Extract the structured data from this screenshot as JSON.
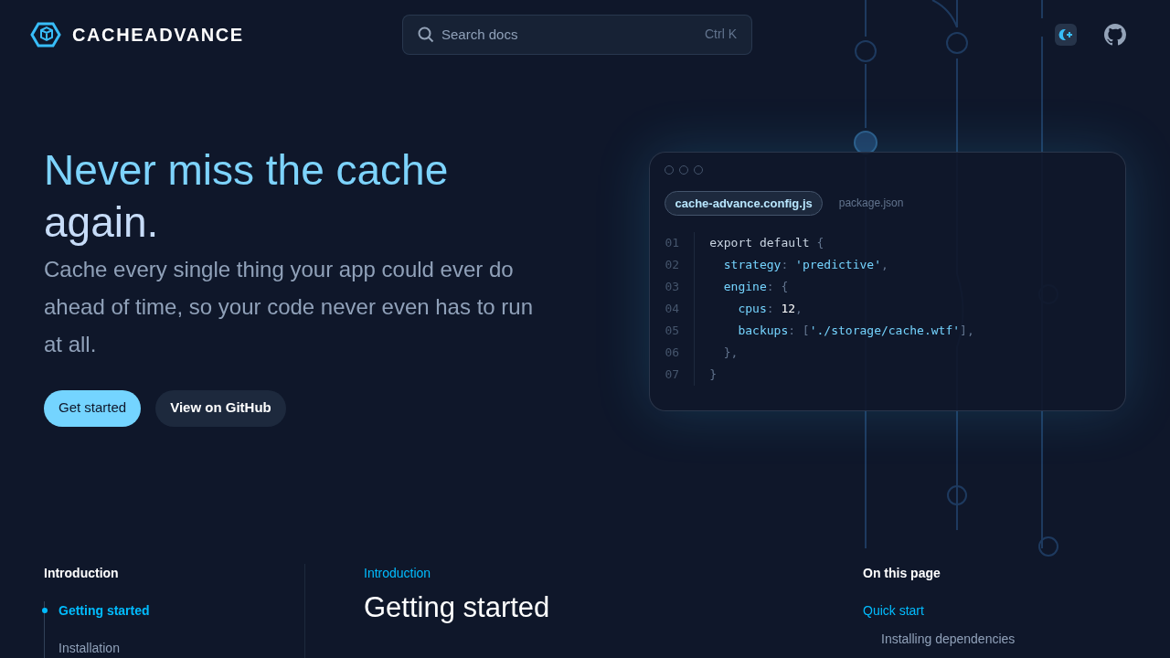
{
  "header": {
    "logo": "CACHEADVANCE",
    "search": {
      "placeholder": "Search docs",
      "shortcut": "Ctrl K"
    }
  },
  "hero": {
    "title_lead": "Never miss the cache",
    "title_rest": "again.",
    "lead": "Cache every single thing your app could ever do ahead of time, so your code never even has to run at all.",
    "buttons": [
      {
        "label": "Get started",
        "kind": "primary"
      },
      {
        "label": "View on GitHub",
        "kind": "secondary"
      }
    ]
  },
  "code_window": {
    "tabs": [
      {
        "label": "cache-advance.config.js",
        "selected": true
      },
      {
        "label": "package.json",
        "selected": false
      }
    ],
    "lines": [
      {
        "number": "01",
        "tokens": [
          {
            "text": "export default ",
            "kind": "plain"
          },
          {
            "text": "{",
            "kind": "punct"
          }
        ]
      },
      {
        "number": "02",
        "tokens": [
          {
            "text": "  strategy",
            "kind": "key"
          },
          {
            "text": ": ",
            "kind": "punct"
          },
          {
            "text": "'predictive'",
            "kind": "string"
          },
          {
            "text": ",",
            "kind": "punct"
          }
        ]
      },
      {
        "number": "03",
        "tokens": [
          {
            "text": "  engine",
            "kind": "key"
          },
          {
            "text": ": {",
            "kind": "punct"
          }
        ]
      },
      {
        "number": "04",
        "tokens": [
          {
            "text": "    cpus",
            "kind": "key"
          },
          {
            "text": ": ",
            "kind": "punct"
          },
          {
            "text": "12",
            "kind": "number"
          },
          {
            "text": ",",
            "kind": "punct"
          }
        ]
      },
      {
        "number": "05",
        "tokens": [
          {
            "text": "    backups",
            "kind": "key"
          },
          {
            "text": ": [",
            "kind": "punct"
          },
          {
            "text": "'./storage/cache.wtf'",
            "kind": "string"
          },
          {
            "text": "],",
            "kind": "punct"
          }
        ]
      },
      {
        "number": "06",
        "tokens": [
          {
            "text": "  },",
            "kind": "punct"
          }
        ]
      },
      {
        "number": "07",
        "tokens": [
          {
            "text": "}",
            "kind": "punct"
          }
        ]
      }
    ]
  },
  "sidebar": {
    "heading": "Introduction",
    "items": [
      {
        "label": "Getting started",
        "selected": true
      },
      {
        "label": "Installation",
        "selected": false
      }
    ]
  },
  "article": {
    "eyebrow": "Introduction",
    "title": "Getting started"
  },
  "toc": {
    "heading": "On this page",
    "items": [
      {
        "label": "Quick start",
        "selected": true,
        "children": [
          {
            "label": "Installing dependencies",
            "selected": false
          }
        ]
      }
    ]
  }
}
